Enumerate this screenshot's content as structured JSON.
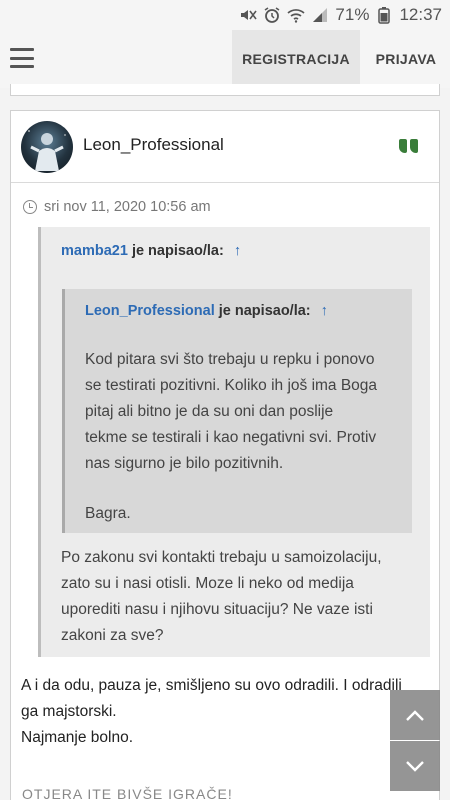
{
  "status_bar": {
    "icons": [
      "mute-icon",
      "alarm-icon",
      "wifi-icon",
      "signal-icon",
      "battery-icon"
    ],
    "battery": "71%",
    "time": "12:37"
  },
  "nav": {
    "register_label": "REGISTRACIJA",
    "login_label": "PRIJAVA"
  },
  "post": {
    "username": "Leon_Professional",
    "date": "sri nov 11, 2020 10:56 am",
    "quote": {
      "author": "mamba21",
      "wrote": "je napisao/la:",
      "arrow": "↑",
      "inner": {
        "author": "Leon_Professional",
        "wrote": "je napisao/la:",
        "arrow": "↑",
        "lines": [
          "Kod pitara svi što trebaju u repku i ponovo",
          "se testirati pozitivni. Koliko ih još ima Boga",
          "pitaj ali bitno je da su oni dan poslije",
          "tekme se testirali i kao negativni svi. Protiv",
          "nas sigurno je bilo pozitivnih."
        ],
        "sign": "Bagra."
      },
      "lines": [
        "Po zakonu svi kontakti trebaju u samoizolaciju,",
        "zato su i nasi otisli. Moze li neko od medija",
        "uporediti nasu i njihovu situaciju? Ne vaze isti",
        "zakoni za sve?"
      ]
    },
    "body_lines": [
      "A i da odu, pauza je, smišljeno su ovo odradili. I odradili",
      "ga majstorski.",
      "Najmanje bolno."
    ]
  },
  "next_post_title": "OTJERA ITE BIVŠE IGRAČE!",
  "colors": {
    "link": "#2d6bb5",
    "quote_icon": "#3a7d3a"
  }
}
